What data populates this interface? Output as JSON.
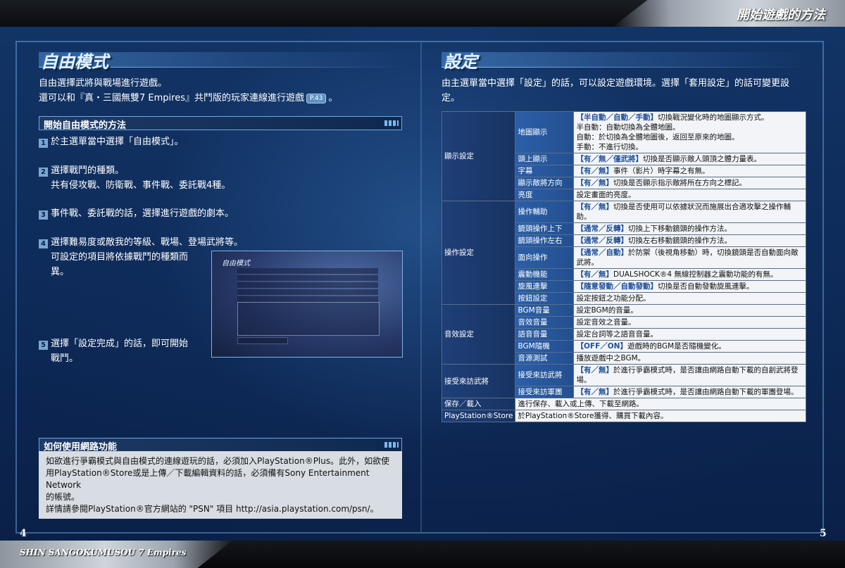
{
  "header_title": "開始遊戲的方法",
  "footer_game": "SHIN SANGOKUMUSOU 7 Empires",
  "page_left": "4",
  "page_right": "5",
  "left": {
    "title": "自由模式",
    "intro_1": "自由選擇武將與戰場進行遊戲。",
    "intro_2": "還可以和『真・三國無雙7 Empires』共鬥版的玩家連線進行遊戲",
    "intro_ref": "P.43",
    "intro_end": "。",
    "sub_heading": "開始自由模式的方法",
    "steps": [
      {
        "n": "1",
        "text": "於主選單當中選擇「自由模式」。"
      },
      {
        "n": "2",
        "text": "選擇戰鬥的種類。",
        "text2": "共有侵攻戰、防衛戰、事件戰、委託戰4種。"
      },
      {
        "n": "3",
        "text": "事件戰、委託戰的話，選擇進行遊戲的劇本。"
      },
      {
        "n": "4",
        "text": "選擇難易度或敵我的等級、戰場、登場武將等。",
        "text2": "可設定的項目將依據戰鬥的種類而",
        "text3": "異。"
      },
      {
        "n": "5",
        "text": "選擇「設定完成」的話，即可開始",
        "text2": "戰鬥。"
      }
    ],
    "screenshot_title": "自由模式",
    "net_heading": "如何使用網路功能",
    "net_text": [
      "如欲進行爭霸模式與自由模式的連線遊玩的話，必須加入PlayStation®Plus。此外，如欲使",
      "用PlayStation®Store或是上傳／下載編輯資料的話，必須備有Sony Entertainment Network",
      "的帳號。",
      "詳情請參閱PlayStation®官方網站的 \"PSN\" 項目 http://asia.playstation.com/psn/。"
    ]
  },
  "right": {
    "title": "設定",
    "intro_1": "由主選單當中選擇「設定」的話，可以設定遊戲環境。選擇「套用設定」的話可變更設",
    "intro_2": "定。",
    "groups": [
      {
        "category": "顯示設定",
        "items": [
          {
            "name": "地圖顯示",
            "opt": "【半自動／自動／手動】",
            "desc": "切換戰況變化時的地圖顯示方式。",
            "extra": [
              "半自動：自動切換為全體地圖。",
              "自動：於切換為全體地圖後，返回至原來的地圖。",
              "手動：不進行切換。"
            ]
          },
          {
            "name": "頭上顯示",
            "opt": "【有／無／僅武將】",
            "desc": "切換是否顯示敵人頭頂之體力量表。"
          },
          {
            "name": "字幕",
            "opt": "【有／無】",
            "desc": "事件（影片）時字幕之有無。"
          },
          {
            "name": "顯示敵將方向",
            "opt": "【有／無】",
            "desc": "切換是否顯示指示敵將所在方向之標記。"
          },
          {
            "name": "亮度",
            "opt": "",
            "desc": "設定畫面的亮度。"
          }
        ]
      },
      {
        "category": "操作設定",
        "items": [
          {
            "name": "操作輔助",
            "opt": "【有／無】",
            "desc": "切換是否使用可以依據狀況而施展出合適攻擊之操作輔助。"
          },
          {
            "name": "鏡頭操作上下",
            "opt": "【通常／反轉】",
            "desc": "切換上下移動鏡頭的操作方法。"
          },
          {
            "name": "鏡頭操作左右",
            "opt": "【通常／反轉】",
            "desc": "切換左右移動鏡頭的操作方法。"
          },
          {
            "name": "面向操作",
            "opt": "【通常／自動】",
            "desc": "於防禦（後視角移動）時，切換鏡頭是否自動面向敵武將。"
          },
          {
            "name": "震動機能",
            "opt": "【有／無】",
            "desc": "DUALSHOCK®4 無線控制器之震動功能的有無。"
          },
          {
            "name": "旋風連擊",
            "opt": "【隨意發動／自動發動】",
            "desc": "切換是否自動發動旋風連擊。"
          },
          {
            "name": "按鈕設定",
            "opt": "",
            "desc": "設定按鈕之功能分配。"
          }
        ]
      },
      {
        "category": "音效設定",
        "items": [
          {
            "name": "BGM音量",
            "opt": "",
            "desc": "設定BGM的音量。"
          },
          {
            "name": "音效音量",
            "opt": "",
            "desc": "設定音效之音量。"
          },
          {
            "name": "語音音量",
            "opt": "",
            "desc": "設定台詞等之語音音量。"
          },
          {
            "name": "BGM隨機",
            "opt": "【OFF／ON】",
            "desc": "遊戲時的BGM是否隨機變化。"
          },
          {
            "name": "音源測試",
            "opt": "",
            "desc": "播放遊戲中之BGM。"
          }
        ]
      },
      {
        "category": "接受來訪武將",
        "items": [
          {
            "name": "接受來訪武將",
            "opt": "【有／無】",
            "desc": "於進行爭霸模式時，是否讓由網路自動下載的自創武將登場。"
          },
          {
            "name": "接受來訪軍團",
            "opt": "【有／無】",
            "desc": "於進行爭霸模式時，是否讓由網路自動下載的軍團登場。"
          }
        ]
      }
    ],
    "single_rows": [
      {
        "category": "保存／載入",
        "desc": "進行保存、載入或上傳、下載至網路。"
      },
      {
        "category": "PlayStation®Store",
        "desc": "於PlayStation®Store獲得、購買下載內容。"
      }
    ]
  }
}
